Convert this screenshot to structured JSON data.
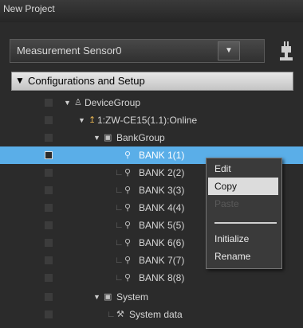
{
  "window": {
    "title": "New Project"
  },
  "device_selector": {
    "value": "Measurement Sensor0",
    "dropdown_glyph": "▼"
  },
  "section": {
    "arrow": "▼",
    "label": "Configurations and Setup"
  },
  "tree": {
    "device_group": "DeviceGroup",
    "controller": "1:ZW-CE15(1.1):Online",
    "bank_group": "BankGroup",
    "banks": [
      "BANK 1(1)",
      "BANK 2(2)",
      "BANK 3(3)",
      "BANK 4(4)",
      "BANK 5(5)",
      "BANK 6(6)",
      "BANK 7(7)",
      "BANK 8(8)"
    ],
    "system": "System",
    "system_data": "System data",
    "expand_glyph": "▼",
    "selected_index": 0
  },
  "context_menu": {
    "items": [
      "Edit",
      "Copy",
      "Paste",
      "Initialize",
      "Rename"
    ],
    "highlighted": "Copy",
    "disabled": [
      "Paste"
    ]
  },
  "colors": {
    "selection": "#5aaee8",
    "menu_highlight": "#dcdcdc"
  }
}
